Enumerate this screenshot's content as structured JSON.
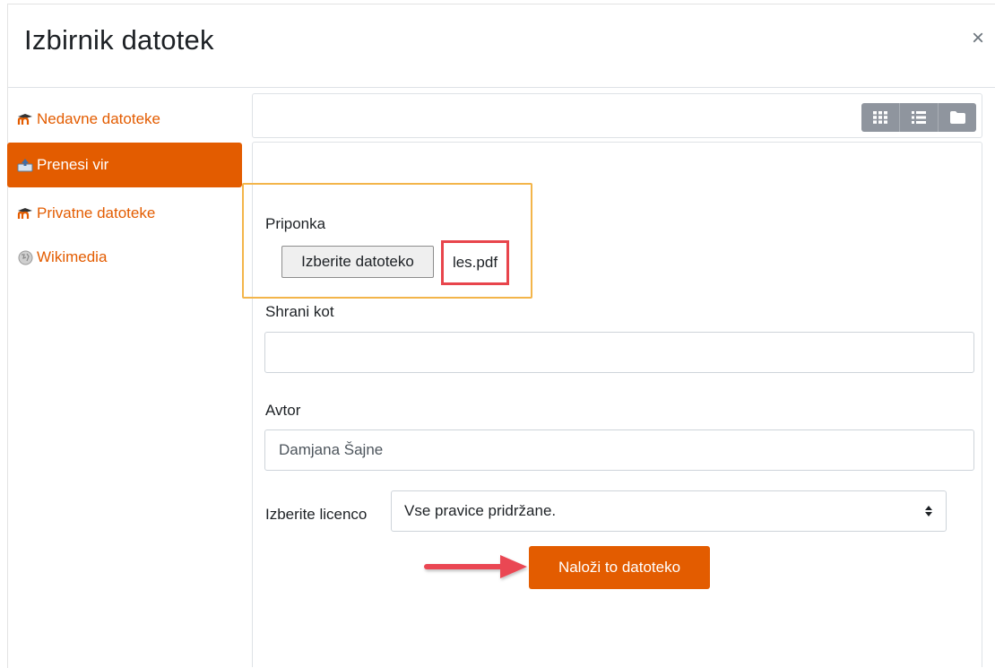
{
  "dialog": {
    "title": "Izbirnik datotek",
    "close_symbol": "×"
  },
  "sidebar": {
    "items": [
      {
        "label": "Nedavne datoteke",
        "icon": "moodle-icon",
        "active": false
      },
      {
        "label": "Prenesi vir",
        "icon": "upload-icon",
        "active": true
      },
      {
        "label": "Privatne datoteke",
        "icon": "moodle-icon",
        "active": false
      },
      {
        "label": "Wikimedia",
        "icon": "wikimedia-icon",
        "active": false
      }
    ]
  },
  "toolbar": {
    "views": [
      "grid-view-icon",
      "list-view-icon",
      "folder-view-icon"
    ]
  },
  "form": {
    "attachment_label": "Priponka",
    "choose_file_label": "Izberite datoteko",
    "file_name": "les.pdf",
    "save_as_label": "Shrani kot",
    "save_as_value": "",
    "author_label": "Avtor",
    "author_value": "Damjana Šajne",
    "license_label": "Izberite licenco",
    "license_value": "Vse pravice pridržane.",
    "upload_button_label": "Naloži to datoteko"
  },
  "colors": {
    "accent": "#e35c00",
    "highlight_border": "#f3b54a",
    "annotation_red": "#e8454c"
  }
}
